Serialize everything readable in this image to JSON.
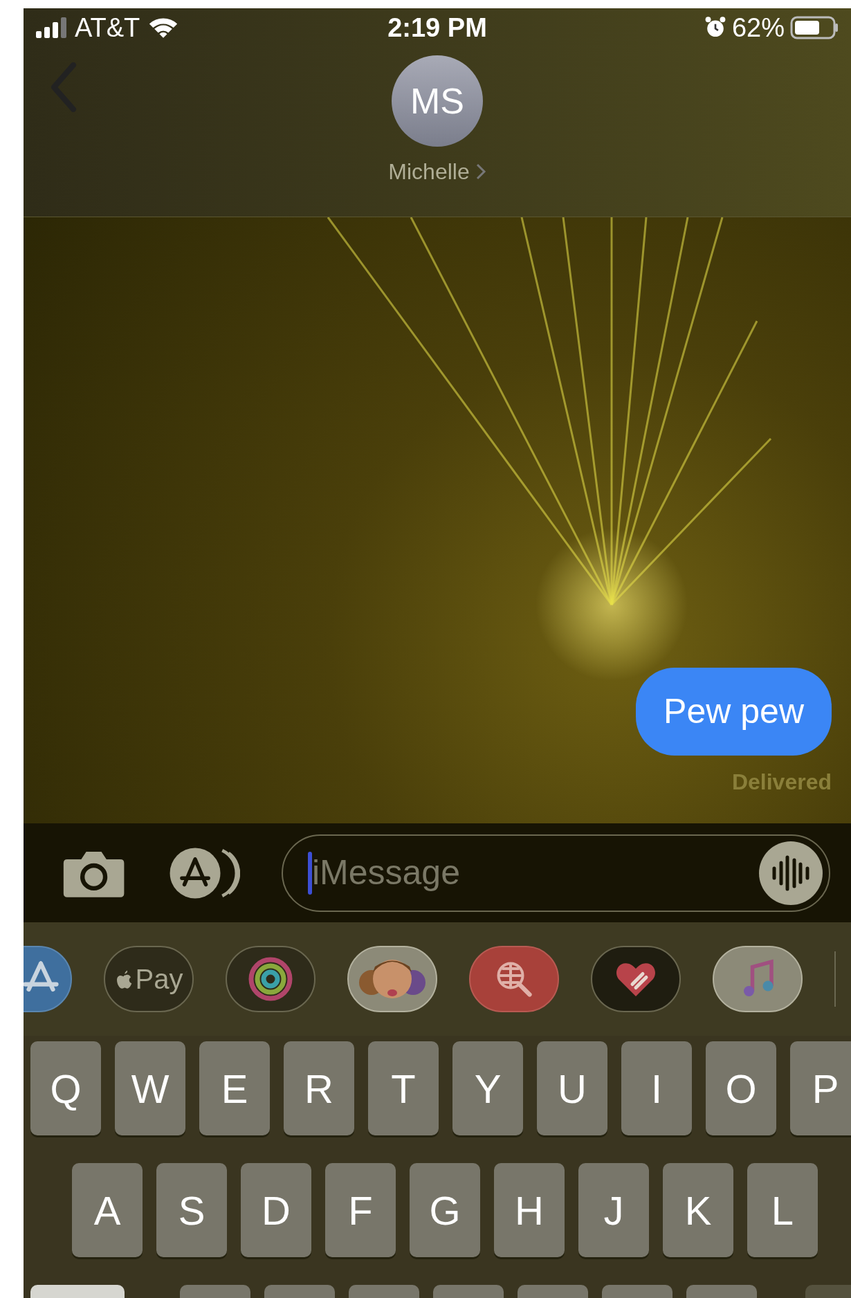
{
  "status_bar": {
    "carrier": "AT&T",
    "time": "2:19 PM",
    "battery": "62%"
  },
  "header": {
    "avatar_initials": "MS",
    "contact_name": "Michelle"
  },
  "messages": [
    {
      "kind": "sent",
      "text": "Pew pew"
    }
  ],
  "delivery_status": "Delivered",
  "composer": {
    "placeholder": "iMessage"
  },
  "app_drawer": [
    {
      "kind": "app-store"
    },
    {
      "kind": "apple-pay",
      "label": "Pay"
    },
    {
      "kind": "activity"
    },
    {
      "kind": "memoji"
    },
    {
      "kind": "image-search"
    },
    {
      "kind": "digital-touch"
    },
    {
      "kind": "music"
    }
  ],
  "keyboard": {
    "rows": [
      [
        "Q",
        "W",
        "E",
        "R",
        "T",
        "Y",
        "U",
        "I",
        "O",
        "P"
      ],
      [
        "A",
        "S",
        "D",
        "F",
        "G",
        "H",
        "J",
        "K",
        "L"
      ]
    ]
  }
}
